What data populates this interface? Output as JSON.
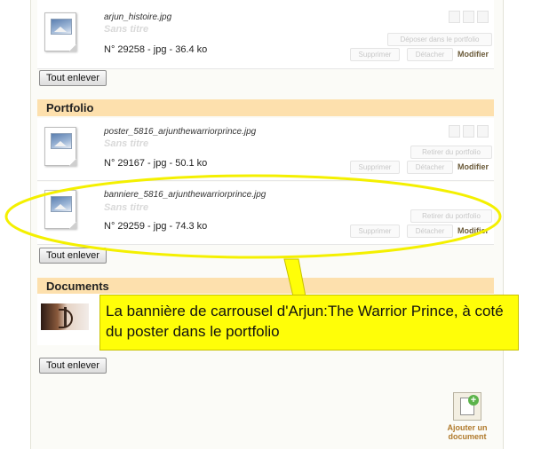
{
  "documents": {
    "header": "Documents",
    "remove_all_label": "Tout enlever"
  },
  "illustrations": {
    "file": {
      "name": "arjun_histoire.jpg",
      "title": "Sans titre",
      "meta": "N° 29258 - jpg - 36.4 ko",
      "actions": {
        "deposit": "Déposer dans le portfolio",
        "delete": "Supprimer",
        "detach": "Détacher",
        "edit": "Modifier"
      }
    },
    "remove_all_label": "Tout enlever"
  },
  "portfolio": {
    "header": "Portfolio",
    "files": [
      {
        "name": "poster_5816_arjunthewarriorprince.jpg",
        "title": "Sans titre",
        "meta": "N° 29167 - jpg - 50.1 ko",
        "actions": {
          "retire": "Retirer du portfolio",
          "delete": "Supprimer",
          "detach": "Détacher",
          "edit": "Modifier"
        }
      },
      {
        "name": "banniere_5816_arjunthewarriorprince.jpg",
        "title": "Sans titre",
        "meta": "N° 29259 - jpg - 74.3 ko",
        "actions": {
          "retire": "Retirer du portfolio",
          "delete": "Supprimer",
          "detach": "Détacher",
          "edit": "Modifier"
        }
      }
    ],
    "remove_all_label": "Tout enlever"
  },
  "annotation": {
    "text": "La bannière de carrousel d'Arjun:The Warrior Prince, à coté du poster dans le portfolio",
    "color": "#fffe08"
  },
  "add_document": {
    "label_line1": "Ajouter un",
    "label_line2": "document"
  }
}
